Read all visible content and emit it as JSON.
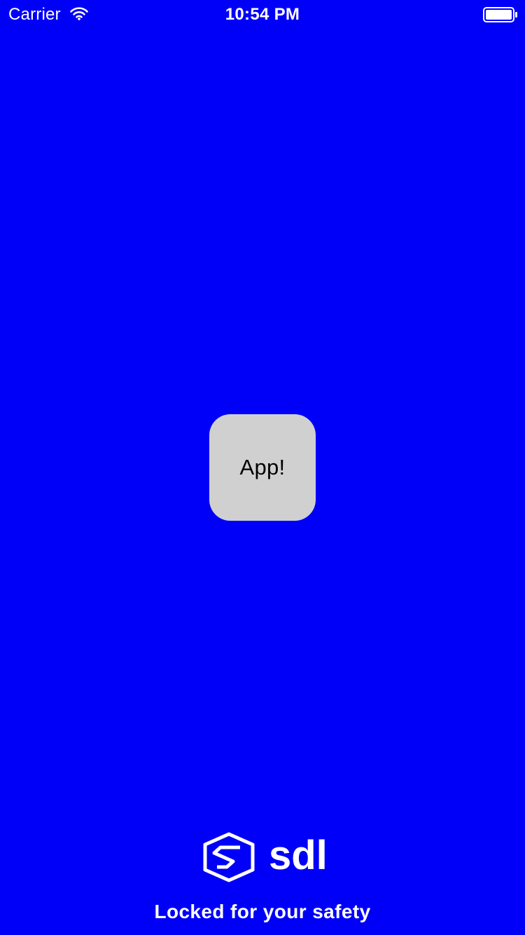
{
  "status_bar": {
    "carrier": "Carrier",
    "time": "10:54 PM"
  },
  "app_tile": {
    "label": "App!"
  },
  "lock_screen": {
    "brand": "sdl",
    "message": "Locked for your safety"
  },
  "colors": {
    "background": "#0000F9",
    "tile": "#D0D0D0",
    "text": "#FFFFFF"
  },
  "icons": {
    "wifi": "wifi-icon",
    "battery": "battery-icon",
    "logo": "sdl-logo-icon"
  }
}
